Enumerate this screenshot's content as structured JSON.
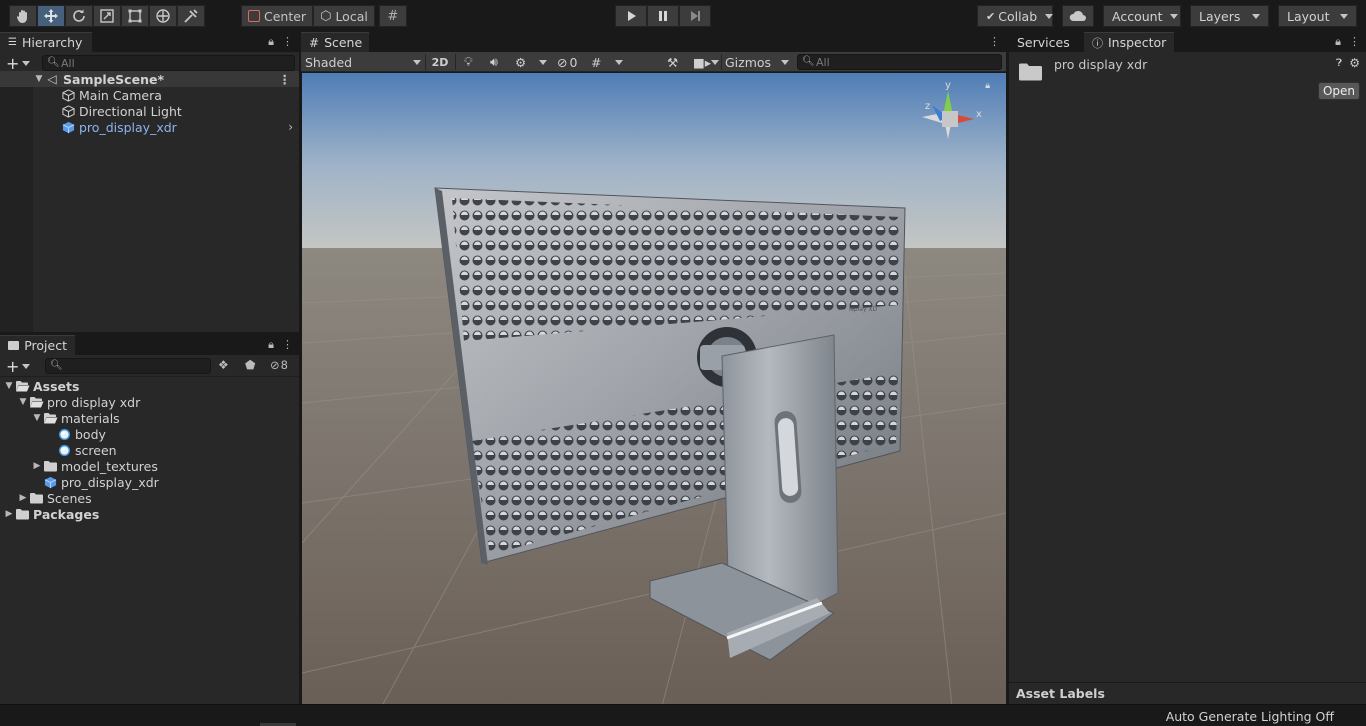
{
  "toolbar": {
    "tools": [
      "hand-tool",
      "move-tool",
      "rotate-tool",
      "scale-tool",
      "rect-tool",
      "transform-tool",
      "custom-tool"
    ],
    "pivot_label": "Center",
    "space_label": "Local",
    "collab_label": "Collab",
    "account_label": "Account",
    "layers_label": "Layers",
    "layout_label": "Layout"
  },
  "hierarchy": {
    "tab_label": "Hierarchy",
    "search_placeholder": "All",
    "scene_name": "SampleScene*",
    "items": [
      {
        "label": "Main Camera",
        "icon": "gameobject-icon"
      },
      {
        "label": "Directional Light",
        "icon": "gameobject-icon"
      },
      {
        "label": "pro_display_xdr",
        "icon": "prefab-icon"
      }
    ]
  },
  "project": {
    "tab_label": "Project",
    "hidden_count": "8",
    "tree": [
      {
        "label": "Assets",
        "depth": 0,
        "expanded": true,
        "bold": true
      },
      {
        "label": "pro display xdr",
        "depth": 1,
        "expanded": true
      },
      {
        "label": "materials",
        "depth": 2,
        "expanded": true
      },
      {
        "label": "body",
        "depth": 3,
        "icon": "material-icon"
      },
      {
        "label": "screen",
        "depth": 3,
        "icon": "material-icon"
      },
      {
        "label": "model_textures",
        "depth": 2,
        "expanded": false
      },
      {
        "label": "pro_display_xdr",
        "depth": 2,
        "icon": "prefab-icon"
      },
      {
        "label": "Scenes",
        "depth": 1,
        "expanded": false
      },
      {
        "label": "Packages",
        "depth": 0,
        "expanded": false,
        "bold": true
      }
    ]
  },
  "scene": {
    "tab_label": "Scene",
    "shading_mode": "Shaded",
    "mode_2d": "2D",
    "hidden_count": "0",
    "gizmos_label": "Gizmos",
    "search_placeholder": "All",
    "gizmo_axes": {
      "y": "y",
      "x": "x",
      "z": "z"
    },
    "model_text": "isplay XD"
  },
  "inspector": {
    "services_tab": "Services",
    "inspector_tab": "Inspector",
    "asset_name": "pro display xdr",
    "open_label": "Open",
    "asset_labels": "Asset Labels"
  },
  "statusbar": {
    "text": "Auto Generate Lighting Off"
  },
  "colors": {
    "prefab_blue": "#8cb4f0",
    "active_tool": "#46607c",
    "panel_bg": "#282828",
    "toolbar_bg": "#191919"
  }
}
